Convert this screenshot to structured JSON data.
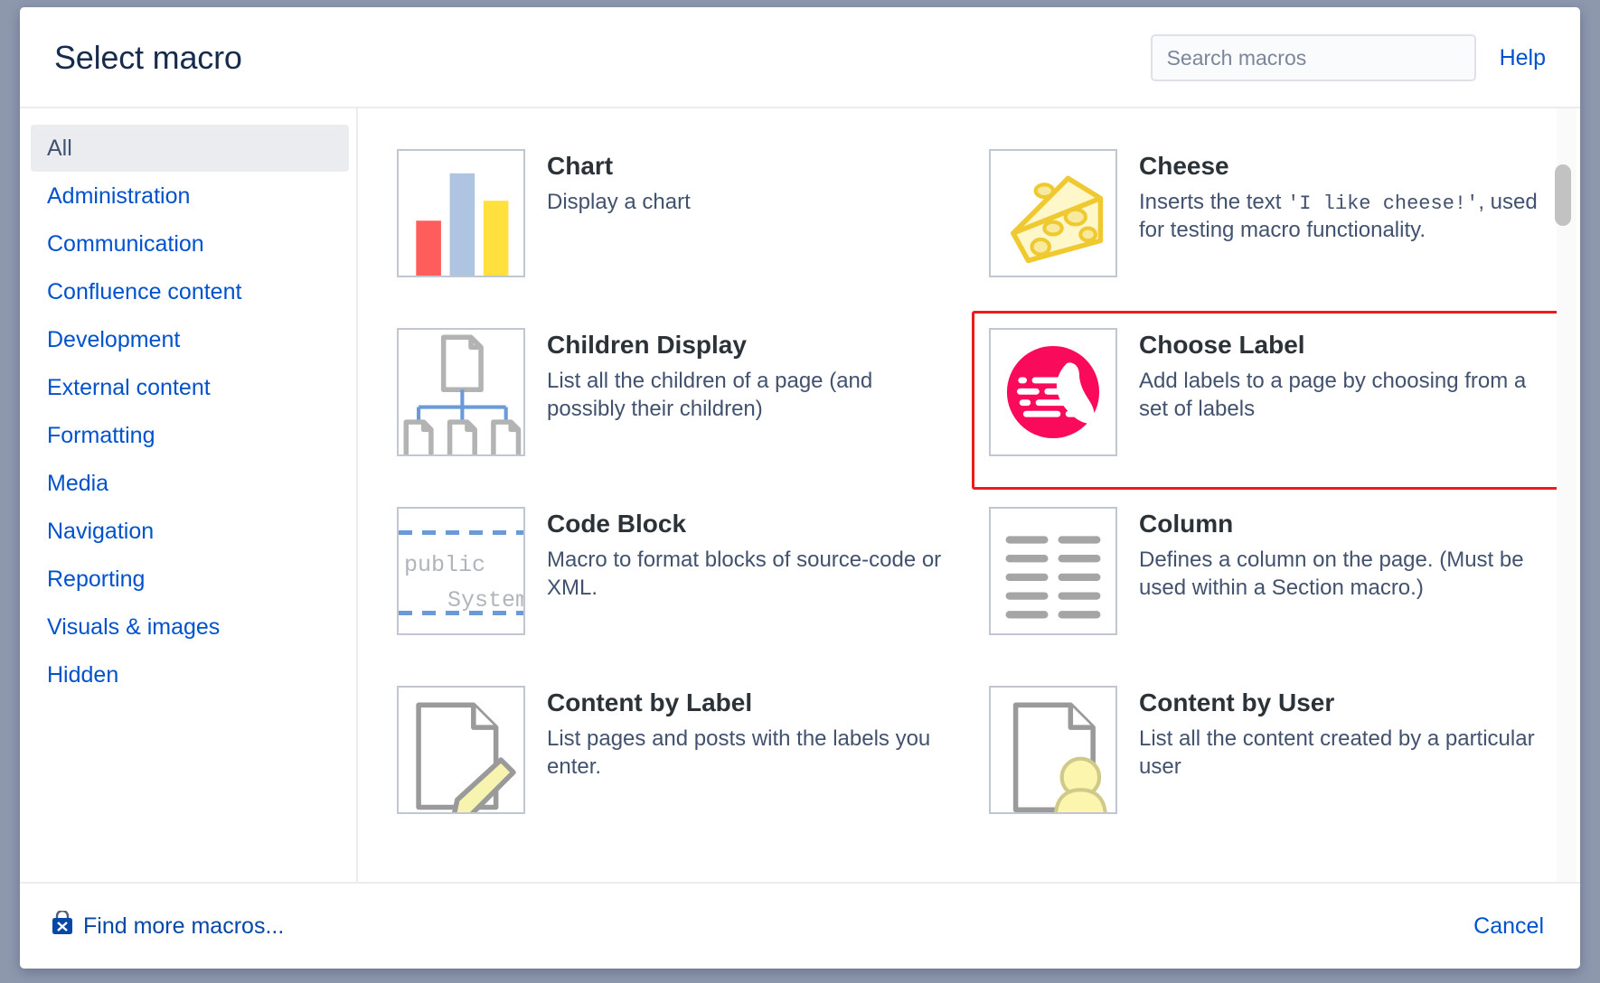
{
  "header": {
    "title": "Select macro",
    "search_placeholder": "Search macros",
    "search_value": "",
    "help_label": "Help"
  },
  "sidebar": {
    "items": [
      {
        "label": "All",
        "selected": true
      },
      {
        "label": "Administration",
        "selected": false
      },
      {
        "label": "Communication",
        "selected": false
      },
      {
        "label": "Confluence content",
        "selected": false
      },
      {
        "label": "Development",
        "selected": false
      },
      {
        "label": "External content",
        "selected": false
      },
      {
        "label": "Formatting",
        "selected": false
      },
      {
        "label": "Media",
        "selected": false
      },
      {
        "label": "Navigation",
        "selected": false
      },
      {
        "label": "Reporting",
        "selected": false
      },
      {
        "label": "Visuals & images",
        "selected": false
      },
      {
        "label": "Hidden",
        "selected": false
      }
    ]
  },
  "macros": [
    {
      "name": "Chart",
      "description": "Display a chart",
      "icon": "bar-chart-icon",
      "highlighted": false
    },
    {
      "name": "Cheese",
      "description_parts": [
        {
          "text": "Inserts the text ",
          "mono": false
        },
        {
          "text": "'I like cheese!'",
          "mono": true
        },
        {
          "text": ", used for testing macro functionality.",
          "mono": false
        }
      ],
      "icon": "cheese-wedge-icon",
      "highlighted": false
    },
    {
      "name": "Children Display",
      "description": "List all the children of a page (and possibly their children)",
      "icon": "page-tree-icon",
      "highlighted": false
    },
    {
      "name": "Choose Label",
      "description": "Add labels to a page by choosing from a set of labels",
      "icon": "running-shoe-icon",
      "highlighted": true
    },
    {
      "name": "Code Block",
      "description": "Macro to format blocks of source-code or XML.",
      "icon": "code-block-icon",
      "code_sample_line1": "public ",
      "code_sample_line2": "System",
      "highlighted": false
    },
    {
      "name": "Column",
      "description": "Defines a column on the page. (Must be used within a Section macro.)",
      "icon": "two-column-lines-icon",
      "highlighted": false
    },
    {
      "name": "Content by Label",
      "description": "List pages and posts with the labels you enter.",
      "icon": "page-pencil-icon",
      "highlighted": false
    },
    {
      "name": "Content by User",
      "description": "List all the content created by a particular user",
      "icon": "page-user-icon",
      "highlighted": false
    }
  ],
  "footer": {
    "find_more_label": "Find more macros...",
    "find_more_icon": "marketplace-bag-icon",
    "cancel_label": "Cancel"
  },
  "colors": {
    "highlight_border": "#ee1b1b",
    "link_blue": "#0052cc",
    "title_navy": "#172b4d",
    "shoe_pink": "#fa0a5a",
    "chart_red": "#ff5c5c",
    "chart_blue": "#aec4e0",
    "chart_yellow": "#ffe03d",
    "cheese_yellow": "#f5d540",
    "tree_blue": "#6a9bd8"
  }
}
